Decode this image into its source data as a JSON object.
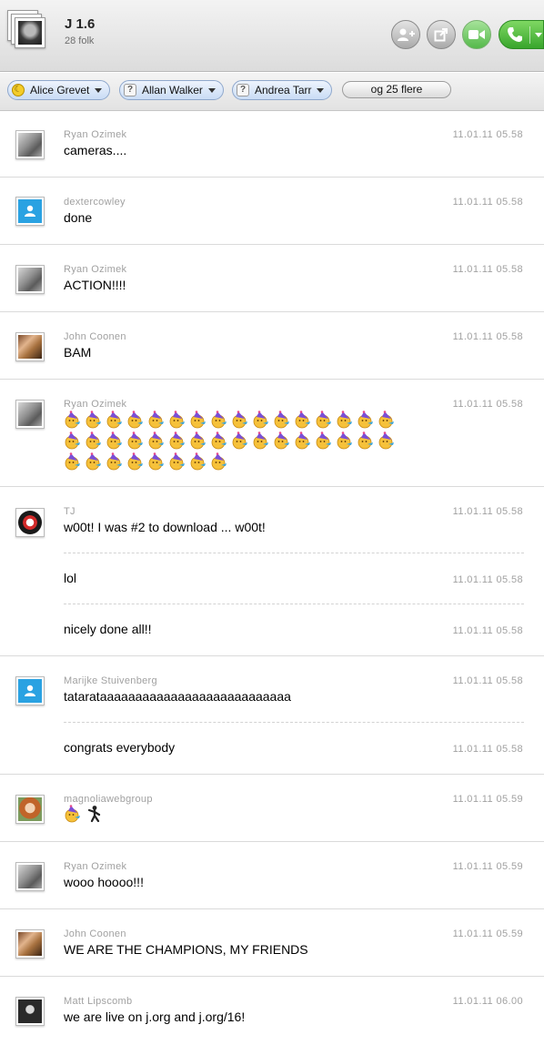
{
  "header": {
    "title": "J 1.6",
    "subtitle": "28 folk",
    "buttons": {
      "add_contact_icon": "add-contact-icon",
      "popout_icon": "popout-icon",
      "video_icon": "video-icon",
      "call_icon": "phone-icon"
    }
  },
  "participants": {
    "chips": [
      {
        "name": "Alice Grevet",
        "status_icon": "moon"
      },
      {
        "name": "Allan Walker",
        "status_icon": "unknown"
      },
      {
        "name": "Andrea Tarr",
        "status_icon": "unknown"
      }
    ],
    "more_label": "og 25 flere"
  },
  "messages": [
    {
      "sender": "Ryan Ozimek",
      "time": "11.01.11 05.58",
      "avatar": "ryan",
      "text": "cameras...."
    },
    {
      "sender": "dextercowley",
      "time": "11.01.11 05.58",
      "avatar": "generic",
      "text": "done"
    },
    {
      "sender": "Ryan Ozimek",
      "time": "11.01.11 05.58",
      "avatar": "ryan",
      "text": "ACTION!!!!"
    },
    {
      "sender": "John Coonen",
      "time": "11.01.11 05.58",
      "avatar": "john",
      "text": "BAM"
    },
    {
      "sender": "Ryan Ozimek",
      "time": "11.01.11 05.58",
      "avatar": "ryan",
      "emoticon": "party",
      "emoticon_count": 40
    },
    {
      "sender": "TJ",
      "time": "11.01.11 05.58",
      "avatar": "tj",
      "text": "w00t!  I was #2 to download ... w00t!",
      "followups": [
        {
          "text": "lol",
          "time": "11.01.11 05.58"
        },
        {
          "text": "nicely done all!!",
          "time": "11.01.11 05.58"
        }
      ]
    },
    {
      "sender": "Marijke Stuivenberg",
      "time": "11.01.11 05.58",
      "avatar": "generic",
      "text": "tatarataaaaaaaaaaaaaaaaaaaaaaaaaaa",
      "followups": [
        {
          "text": "congrats everybody",
          "time": "11.01.11 05.58"
        }
      ]
    },
    {
      "sender": "magnoliawebgroup",
      "time": "11.01.11 05.59",
      "avatar": "magnolia",
      "emoticons": [
        "party",
        "dance"
      ]
    },
    {
      "sender": "Ryan Ozimek",
      "time": "11.01.11 05.59",
      "avatar": "ryan",
      "text": "wooo hoooo!!!"
    },
    {
      "sender": "John Coonen",
      "time": "11.01.11 05.59",
      "avatar": "john",
      "text": "WE ARE THE CHAMPIONS, MY FRIENDS"
    },
    {
      "sender": "Matt Lipscomb",
      "time": "11.01.11 06.00",
      "avatar": "matt",
      "text": "we are live on j.org and j.org/16!"
    }
  ]
}
